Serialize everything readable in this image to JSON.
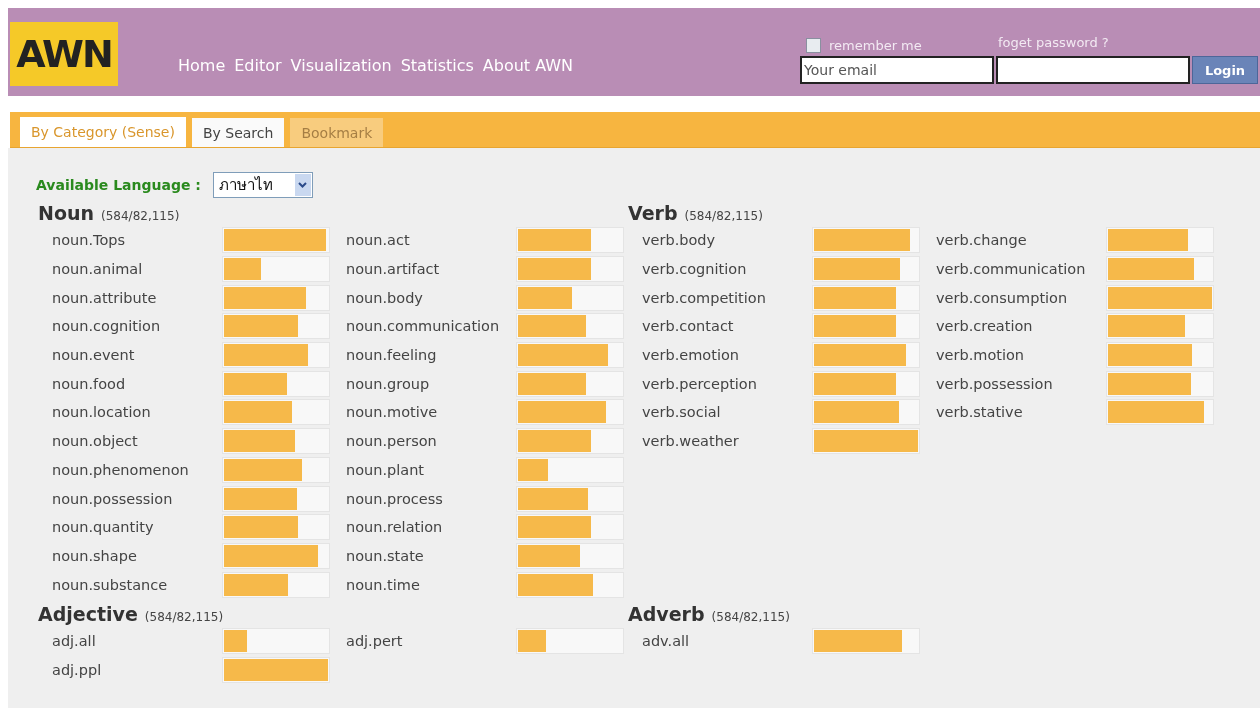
{
  "header": {
    "logo": "AWN",
    "nav": [
      {
        "label": "Home"
      },
      {
        "label": "Editor"
      },
      {
        "label": "Visualization"
      },
      {
        "label": "Statistics"
      },
      {
        "label": "About AWN"
      }
    ],
    "login": {
      "remember_label": "remember me",
      "remember_checked": false,
      "forgot_link": "foget password ?",
      "email_placeholder": "Your email",
      "button": "Login"
    }
  },
  "tabs": [
    {
      "label": "By Category (Sense)",
      "selected": true,
      "disabled": false
    },
    {
      "label": "By Search",
      "selected": false,
      "disabled": false
    },
    {
      "label": "Bookmark",
      "selected": false,
      "disabled": true
    }
  ],
  "language": {
    "label": "Available Language :",
    "value": "ภาษาไท"
  },
  "sections": [
    {
      "title": "Noun",
      "count": "(584/82,115)",
      "columns": [
        [
          {
            "name": "noun.Tops",
            "level": 0.98
          },
          {
            "name": "noun.animal",
            "level": 0.36
          },
          {
            "name": "noun.attribute",
            "level": 0.79
          },
          {
            "name": "noun.cognition",
            "level": 0.71
          },
          {
            "name": "noun.event",
            "level": 0.81
          },
          {
            "name": "noun.food",
            "level": 0.61
          },
          {
            "name": "noun.location",
            "level": 0.65
          },
          {
            "name": "noun.object",
            "level": 0.68
          },
          {
            "name": "noun.phenomenon",
            "level": 0.75
          },
          {
            "name": "noun.possession",
            "level": 0.7
          },
          {
            "name": "noun.quantity",
            "level": 0.71
          },
          {
            "name": "noun.shape",
            "level": 0.9
          },
          {
            "name": "noun.substance",
            "level": 0.62
          }
        ],
        [
          {
            "name": "noun.act",
            "level": 0.7
          },
          {
            "name": "noun.artifact",
            "level": 0.7
          },
          {
            "name": "noun.body",
            "level": 0.52
          },
          {
            "name": "noun.communication",
            "level": 0.65
          },
          {
            "name": "noun.feeling",
            "level": 0.87
          },
          {
            "name": "noun.group",
            "level": 0.65
          },
          {
            "name": "noun.motive",
            "level": 0.85
          },
          {
            "name": "noun.person",
            "level": 0.7
          },
          {
            "name": "noun.plant",
            "level": 0.29
          },
          {
            "name": "noun.process",
            "level": 0.67
          },
          {
            "name": "noun.relation",
            "level": 0.7
          },
          {
            "name": "noun.state",
            "level": 0.6
          },
          {
            "name": "noun.time",
            "level": 0.72
          }
        ]
      ]
    },
    {
      "title": "Verb",
      "count": "(584/82,115)",
      "columns": [
        [
          {
            "name": "verb.body",
            "level": 0.92
          },
          {
            "name": "verb.cognition",
            "level": 0.83
          },
          {
            "name": "verb.competition",
            "level": 0.79
          },
          {
            "name": "verb.contact",
            "level": 0.79
          },
          {
            "name": "verb.emotion",
            "level": 0.88
          },
          {
            "name": "verb.perception",
            "level": 0.79
          },
          {
            "name": "verb.social",
            "level": 0.82
          },
          {
            "name": "verb.weather",
            "level": 1.0
          }
        ],
        [
          {
            "name": "verb.change",
            "level": 0.77
          },
          {
            "name": "verb.communication",
            "level": 0.83
          },
          {
            "name": "verb.consumption",
            "level": 1.0
          },
          {
            "name": "verb.creation",
            "level": 0.74
          },
          {
            "name": "verb.motion",
            "level": 0.81
          },
          {
            "name": "verb.possession",
            "level": 0.8
          },
          {
            "name": "verb.stative",
            "level": 0.92
          }
        ]
      ]
    },
    {
      "title": "Adjective",
      "count": "(584/82,115)",
      "columns": [
        [
          {
            "name": "adj.all",
            "level": 0.22
          },
          {
            "name": "adj.ppl",
            "level": 1.0
          }
        ],
        [
          {
            "name": "adj.pert",
            "level": 0.27
          }
        ]
      ]
    },
    {
      "title": "Adverb",
      "count": "(584/82,115)",
      "columns": [
        [
          {
            "name": "adv.all",
            "level": 0.85
          }
        ]
      ]
    }
  ]
}
